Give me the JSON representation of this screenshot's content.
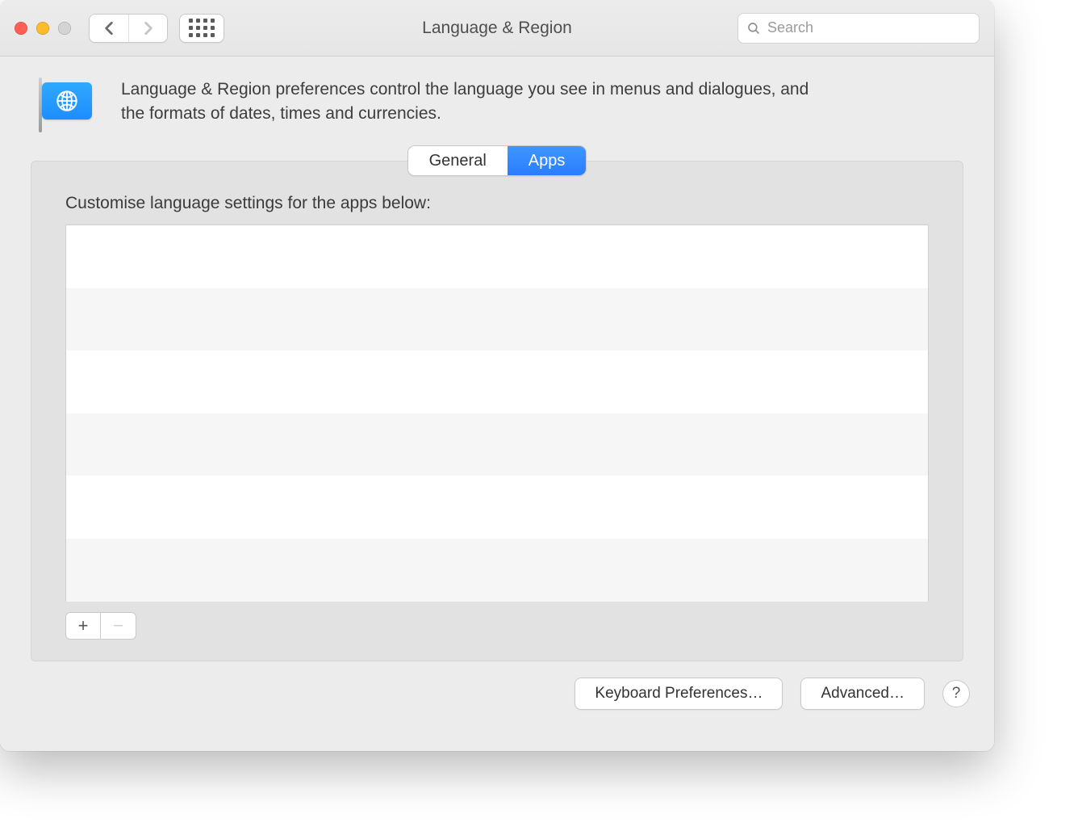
{
  "window": {
    "title": "Language & Region"
  },
  "search": {
    "placeholder": "Search"
  },
  "header": {
    "description": "Language & Region preferences control the language you see in menus and dialogues, and the formats of dates, times and currencies."
  },
  "tabs": {
    "general": "General",
    "apps": "Apps",
    "active": "apps"
  },
  "panel": {
    "label": "Customise language settings for the apps below:",
    "items": []
  },
  "addrem": {
    "add_label": "+",
    "remove_label": "−"
  },
  "bottom": {
    "keyboard": "Keyboard Preferences…",
    "advanced": "Advanced…",
    "help": "?"
  },
  "colors": {
    "accent": "#2a7dff"
  }
}
